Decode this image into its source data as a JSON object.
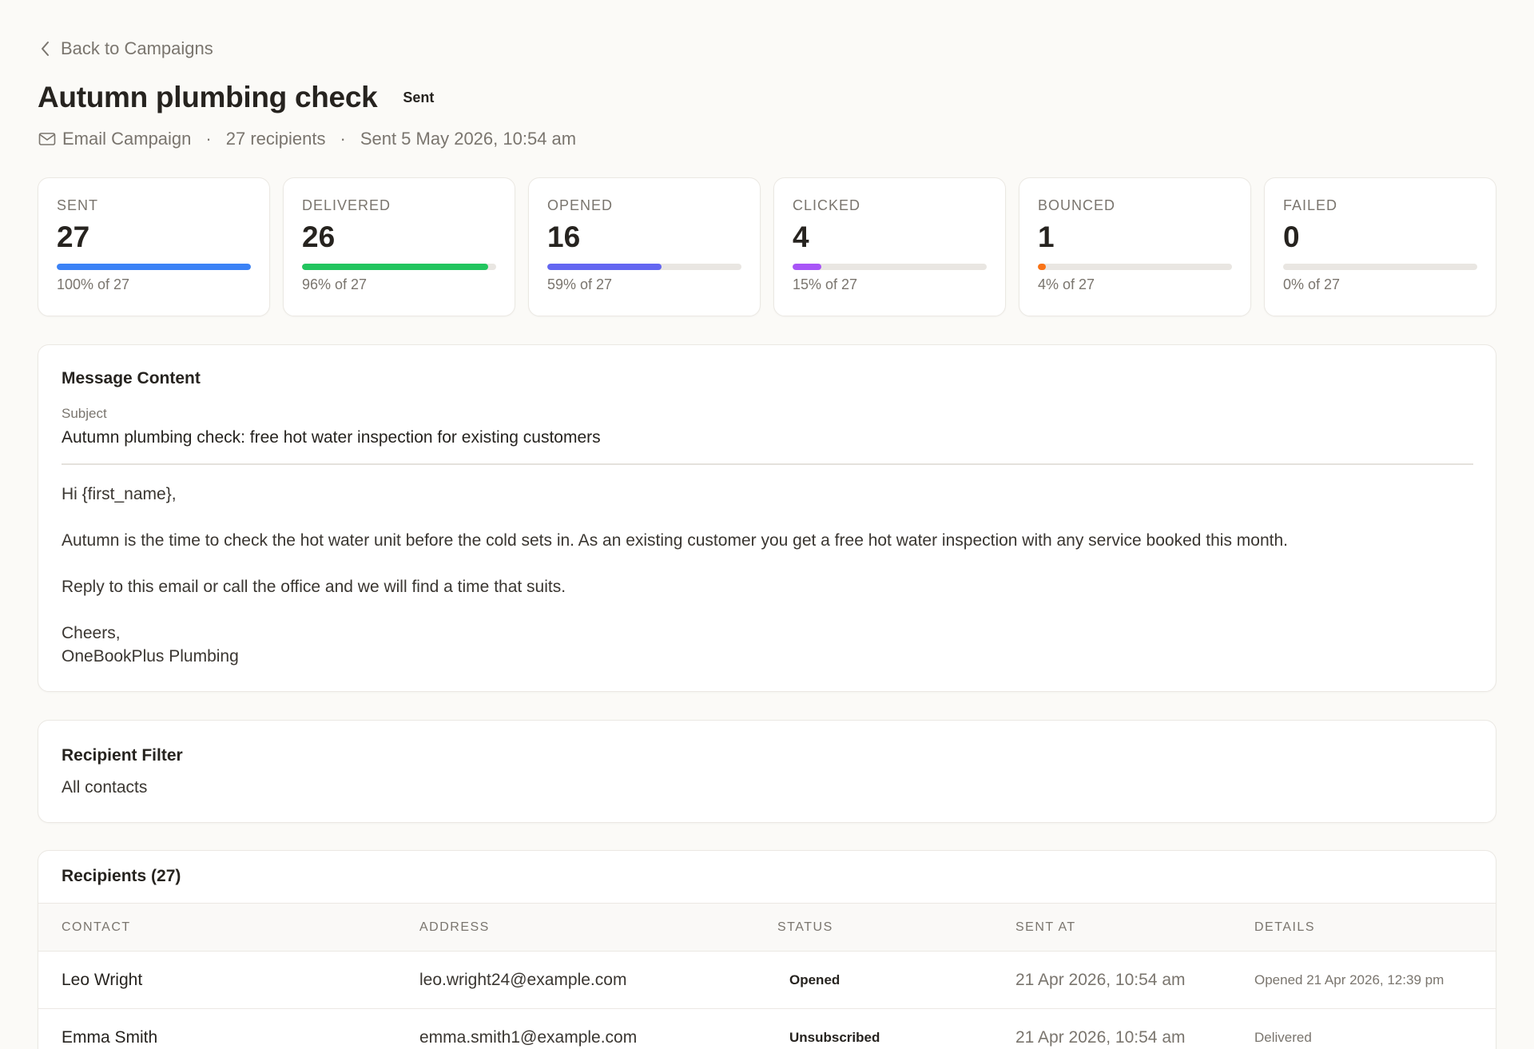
{
  "nav": {
    "back_label": "Back to Campaigns"
  },
  "campaign": {
    "title": "Autumn plumbing check",
    "status_badge": "Sent",
    "type": "Email Campaign",
    "recipients": "27 recipients",
    "sent_at": "Sent 5 May 2026, 10:54 am",
    "separator": "·"
  },
  "stats": [
    {
      "label": "SENT",
      "value": "27",
      "sub": "100% of 27",
      "fraction": 1.0,
      "color": "#3b82f6"
    },
    {
      "label": "DELIVERED",
      "value": "26",
      "sub": "96% of 27",
      "fraction": 0.96,
      "color": "#22c55e"
    },
    {
      "label": "OPENED",
      "value": "16",
      "sub": "59% of 27",
      "fraction": 0.59,
      "color": "#6366f1"
    },
    {
      "label": "CLICKED",
      "value": "4",
      "sub": "15% of 27",
      "fraction": 0.15,
      "color": "#a855f7"
    },
    {
      "label": "BOUNCED",
      "value": "1",
      "sub": "4% of 27",
      "fraction": 0.04,
      "color": "#f97316"
    },
    {
      "label": "FAILED",
      "value": "0",
      "sub": "0% of 27",
      "fraction": 0.0,
      "color": "#ef4444"
    }
  ],
  "message": {
    "title": "Message Content",
    "subject_label": "Subject",
    "subject": "Autumn plumbing check: free hot water inspection for existing customers",
    "greeting": "Hi {first_name},",
    "para1": "Autumn is the time to check the hot water unit before the cold sets in. As an existing customer you get a free hot water inspection with any service booked this month.",
    "para2": "Reply to this email or call the office and we will find a time that suits.",
    "signoff": "Cheers,",
    "signature": "OneBookPlus Plumbing"
  },
  "filter": {
    "title": "Recipient Filter",
    "value": "All contacts"
  },
  "recipients": {
    "title": "Recipients (27)",
    "columns": [
      "CONTACT",
      "ADDRESS",
      "STATUS",
      "SENT AT",
      "DETAILS"
    ],
    "rows": [
      {
        "contact": "Leo Wright",
        "address": "leo.wright24@example.com",
        "status": "Opened",
        "sent_at": "21 Apr 2026, 10:54 am",
        "details": "Opened 21 Apr 2026, 12:39 pm"
      },
      {
        "contact": "Emma Smith",
        "address": "emma.smith1@example.com",
        "status": "Unsubscribed",
        "sent_at": "21 Apr 2026, 10:54 am",
        "details": "Delivered"
      }
    ]
  }
}
